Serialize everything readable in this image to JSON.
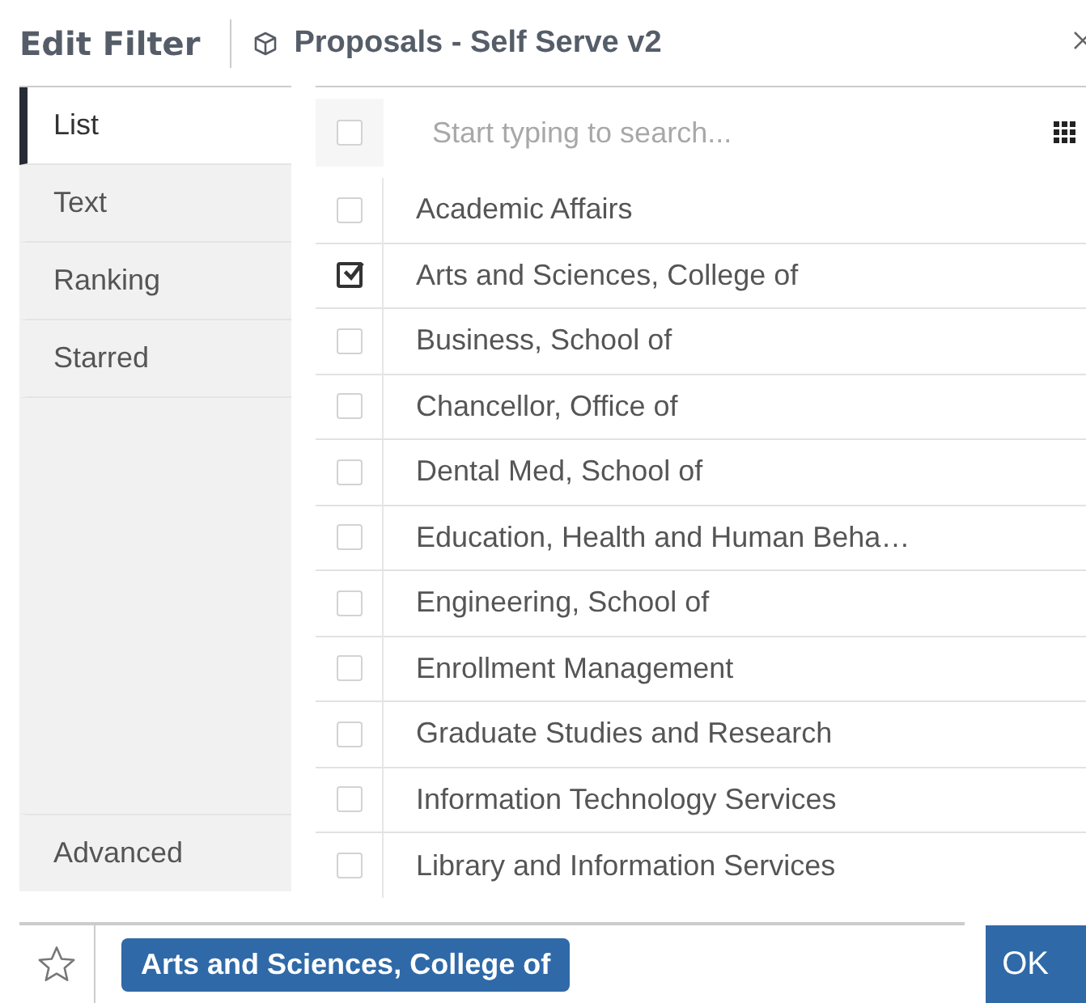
{
  "header": {
    "title": "Edit Filter",
    "source": "Proposals - Self Serve v2"
  },
  "tabs": [
    {
      "label": "List",
      "selected": true
    },
    {
      "label": "Text",
      "selected": false
    },
    {
      "label": "Ranking",
      "selected": false
    },
    {
      "label": "Starred",
      "selected": false
    }
  ],
  "advanced": {
    "label": "Advanced",
    "selected": false
  },
  "search": {
    "placeholder": "Start typing to search...",
    "checked": false
  },
  "items": [
    {
      "label": "Academic Affairs",
      "checked": false
    },
    {
      "label": "Arts and Sciences, College of",
      "checked": true
    },
    {
      "label": "Business, School of",
      "checked": false
    },
    {
      "label": "Chancellor, Office of",
      "checked": false
    },
    {
      "label": "Dental Med, School of",
      "checked": false
    },
    {
      "label": "Education, Health and Human Beha…",
      "checked": false
    },
    {
      "label": "Engineering, School of",
      "checked": false
    },
    {
      "label": "Enrollment Management",
      "checked": false
    },
    {
      "label": "Graduate Studies and Research",
      "checked": false
    },
    {
      "label": "Information Technology Services",
      "checked": false
    },
    {
      "label": "Library and Information Services",
      "checked": false
    }
  ],
  "chips": [
    "Arts and Sciences, College of"
  ],
  "ok": "OK"
}
